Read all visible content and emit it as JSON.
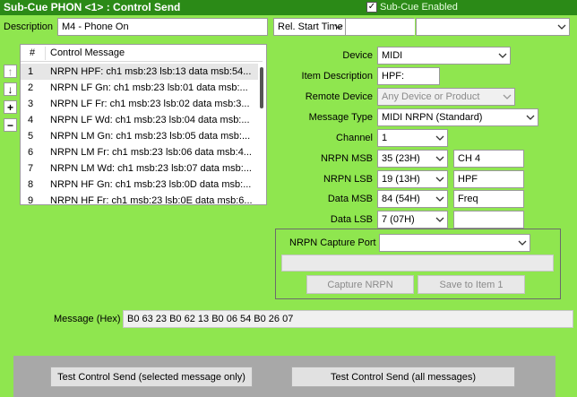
{
  "window": {
    "title": "Sub-Cue PHON <1> : Control Send",
    "subcue_enabled_label": "Sub-Cue Enabled",
    "subcue_enabled_check": "✓"
  },
  "description": {
    "label": "Description",
    "value": "M4 - Phone On"
  },
  "timing": {
    "mode": "Rel. Start Time",
    "value": "",
    "extra": ""
  },
  "list": {
    "col_num": "#",
    "col_msg": "Control Message",
    "rows": [
      {
        "num": "1",
        "msg": "NRPN HPF:  ch1 msb:23 lsb:13 data msb:54..."
      },
      {
        "num": "2",
        "msg": "NRPN LF Gn:  ch1 msb:23 lsb:01 data msb:..."
      },
      {
        "num": "3",
        "msg": "NRPN LF Fr:  ch1 msb:23 lsb:02 data msb:3..."
      },
      {
        "num": "4",
        "msg": "NRPN LF Wd:  ch1 msb:23 lsb:04 data msb:..."
      },
      {
        "num": "5",
        "msg": "NRPN LM Gn:  ch1 msb:23 lsb:05 data msb:..."
      },
      {
        "num": "6",
        "msg": "NRPN LM Fr:  ch1 msb:23 lsb:06 data msb:4..."
      },
      {
        "num": "7",
        "msg": "NRPN LM Wd:  ch1 msb:23 lsb:07 data msb:..."
      },
      {
        "num": "8",
        "msg": "NRPN HF Gn:  ch1 msb:23 lsb:0D data msb:..."
      },
      {
        "num": "9",
        "msg": "NRPN HF Fr:  ch1 msb:23 lsb:0E data msb:6..."
      }
    ]
  },
  "side_buttons": {
    "up": "↑",
    "down": "↓",
    "add": "+",
    "remove": "−"
  },
  "form": {
    "device_label": "Device",
    "device_value": "MIDI",
    "item_desc_label": "Item Description",
    "item_desc_value": "HPF:",
    "remote_device_label": "Remote Device",
    "remote_device_value": "Any Device or Product",
    "message_type_label": "Message Type",
    "message_type_value": "MIDI NRPN (Standard)",
    "channel_label": "Channel",
    "channel_value": "1",
    "nrpn_msb_label": "NRPN MSB",
    "nrpn_msb_value": "35  (23H)",
    "nrpn_msb_note": "CH 4",
    "nrpn_lsb_label": "NRPN LSB",
    "nrpn_lsb_value": "19  (13H)",
    "nrpn_lsb_note": "HPF",
    "data_msb_label": "Data MSB",
    "data_msb_value": "84  (54H)",
    "data_msb_note": "Freq",
    "data_lsb_label": "Data LSB",
    "data_lsb_value": "7  (07H)",
    "data_lsb_note": ""
  },
  "capture": {
    "port_label": "NRPN Capture Port",
    "port_value": "",
    "status": "",
    "capture_button": "Capture NRPN",
    "save_button": "Save to Item 1"
  },
  "hex": {
    "label": "Message (Hex)",
    "value": "B0 63 23 B0 62 13 B0 06 54 B0 26 07"
  },
  "test": {
    "selected_button": "Test Control Send (selected message only)",
    "all_button": "Test Control Send (all messages)"
  },
  "colors": {
    "background": "#8fe64f",
    "titlebar": "#2b8a17"
  }
}
